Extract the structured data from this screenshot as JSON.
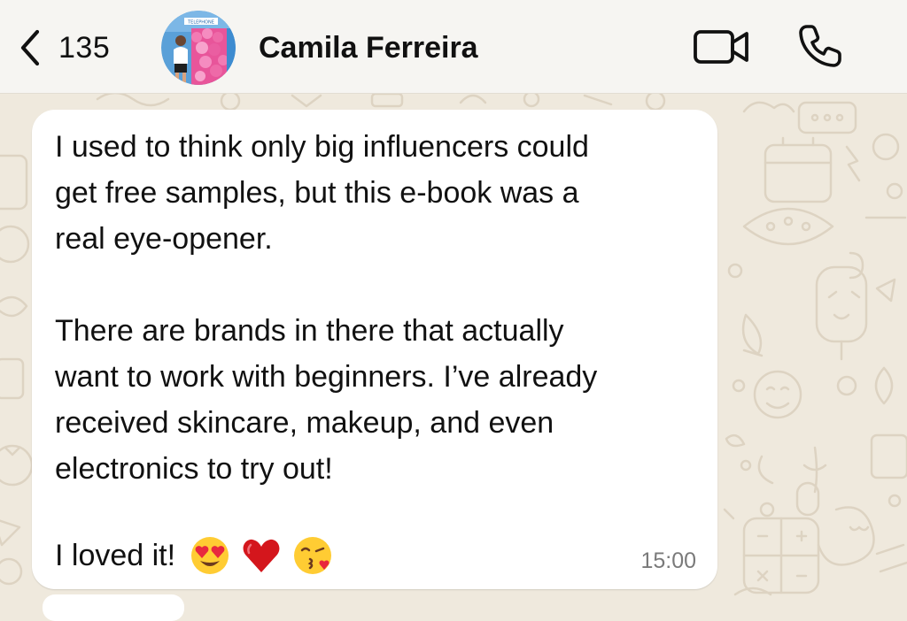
{
  "header": {
    "back_count": "135",
    "contact_name": "Camila Ferreira",
    "avatar_sign_text": "TELEPHONE"
  },
  "icons": {
    "back": "chevron-left-icon",
    "video": "video-camera-icon",
    "call": "phone-icon",
    "emojis": [
      "heart-eyes-emoji",
      "red-heart-emoji",
      "face-blowing-kiss-emoji"
    ]
  },
  "message": {
    "paragraph_1": "I used to think only big influencers could\nget free samples, but this e-book was a\nreal eye-opener.",
    "paragraph_2": "There are brands in there that actually\nwant to work with beginners. I’ve already\nreceived skincare, makeup, and even\nelectronics to try out!",
    "paragraph_3": "I loved it!",
    "time": "15:00"
  },
  "colors": {
    "wallpaper": "#efe9dd",
    "header_bg": "#f6f5f2",
    "bubble_bg": "#ffffff",
    "text": "#111111",
    "timestamp": "#7a7a7a"
  }
}
